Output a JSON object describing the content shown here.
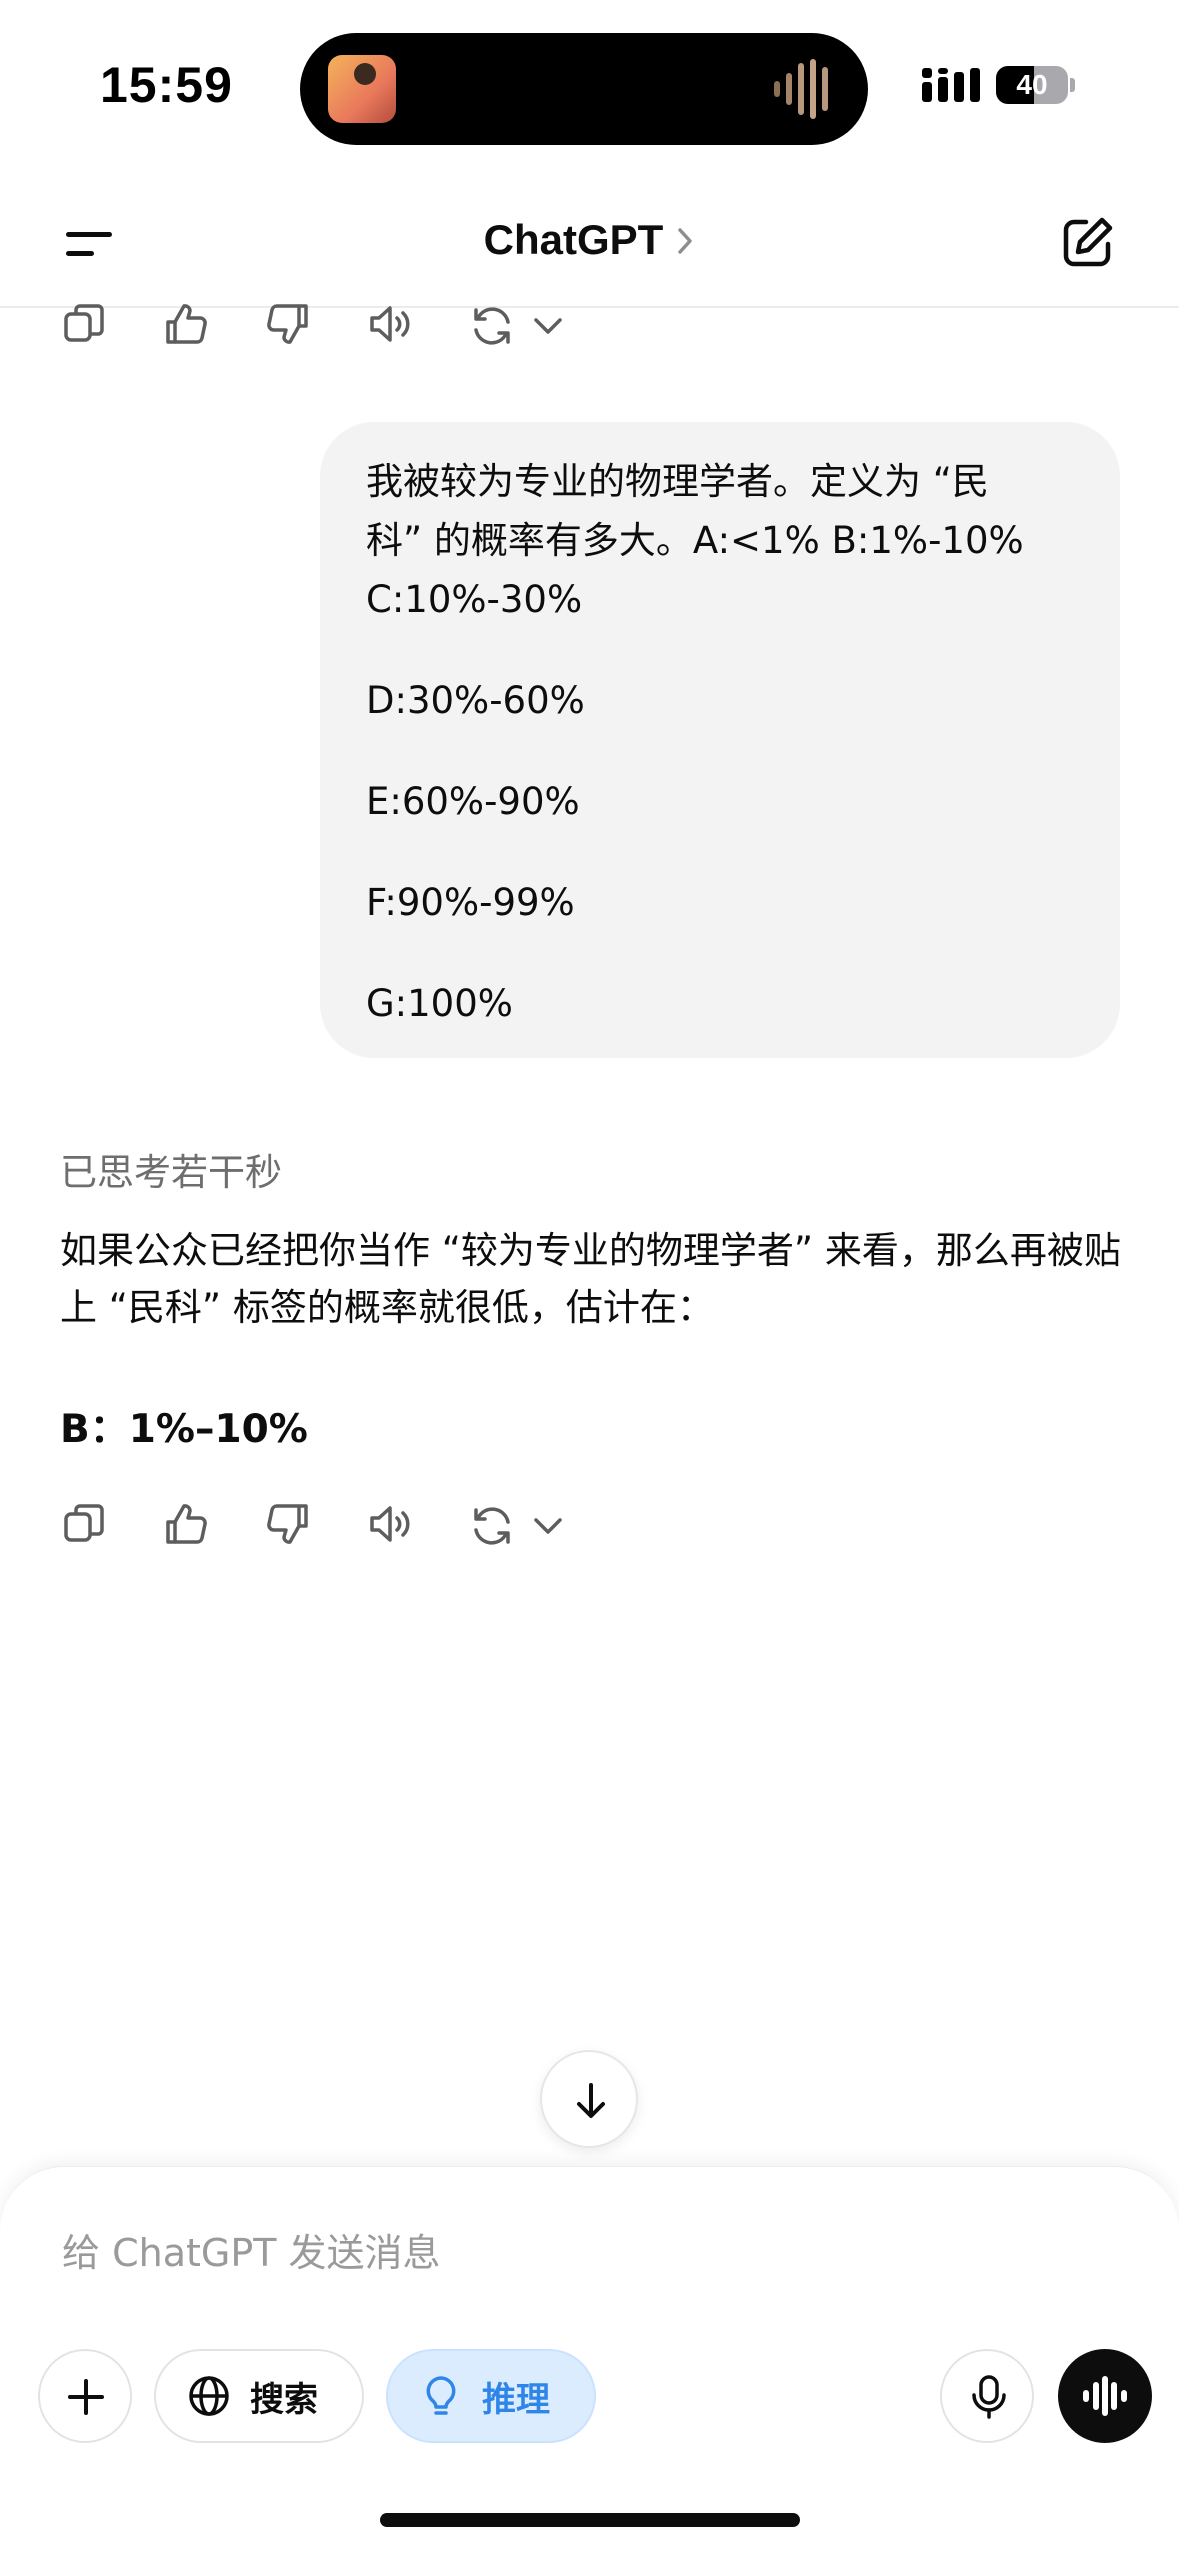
{
  "status_bar": {
    "time": "15:59",
    "battery_level": "40"
  },
  "header": {
    "title": "ChatGPT"
  },
  "conversation": {
    "user_message": {
      "lines": [
        "我被较为专业的物理学者。定义为 “民",
        "科” 的概率有多大。A:<1% B:1%-10%",
        "C:10%-30%"
      ],
      "options": [
        "D:30%-60%",
        "E:60%-90%",
        "F:90%-99%",
        "G:100%"
      ]
    },
    "assistant": {
      "thought_label": "已思考若干秒",
      "text": "如果公众已经把你当作 “较为专业的物理学者” 来看，那么再被贴上 “民科” 标签的概率就很低，估计在：",
      "answer": "B：1%–10%"
    }
  },
  "composer": {
    "placeholder": "给 ChatGPT 发送消息",
    "search_label": "搜索",
    "reason_label": "推理"
  },
  "colors": {
    "bubble_bg": "#f3f3f3",
    "accent_blue": "#2f86e8",
    "reason_bg": "#dcecff"
  }
}
